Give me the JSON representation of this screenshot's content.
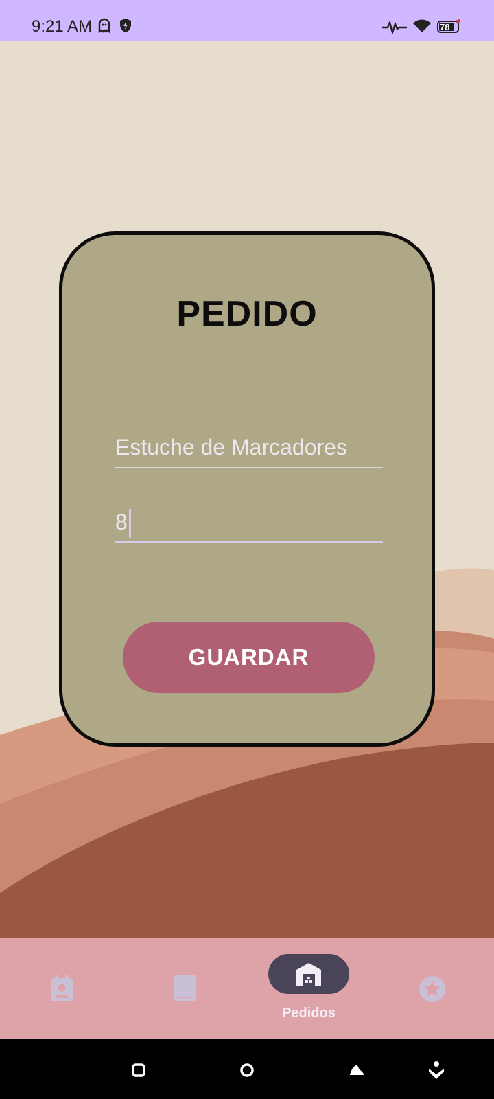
{
  "status_bar": {
    "time": "9:21 AM",
    "battery": "78",
    "icons": [
      "ghost-icon",
      "shield-icon",
      "activity-icon",
      "wifi-icon",
      "battery-icon"
    ],
    "bg_color": "#cfb8ff"
  },
  "card": {
    "title": "PEDIDO",
    "product_field": {
      "value": "Estuche de Marcadores"
    },
    "quantity_field": {
      "value": "8"
    },
    "save_label": "GUARDAR",
    "bg_color": "#afa887",
    "button_color": "#b06072"
  },
  "bottom_nav": {
    "items": [
      {
        "icon": "contact-card-icon",
        "label": ""
      },
      {
        "icon": "book-icon",
        "label": ""
      },
      {
        "icon": "warehouse-icon",
        "label": "Pedidos",
        "active": true
      },
      {
        "icon": "star-badge-icon",
        "label": ""
      }
    ],
    "bg_color": "#dea3a9"
  },
  "system_nav": {
    "buttons": [
      "recents-icon",
      "home-icon",
      "back-icon",
      "accessibility-icon"
    ]
  }
}
